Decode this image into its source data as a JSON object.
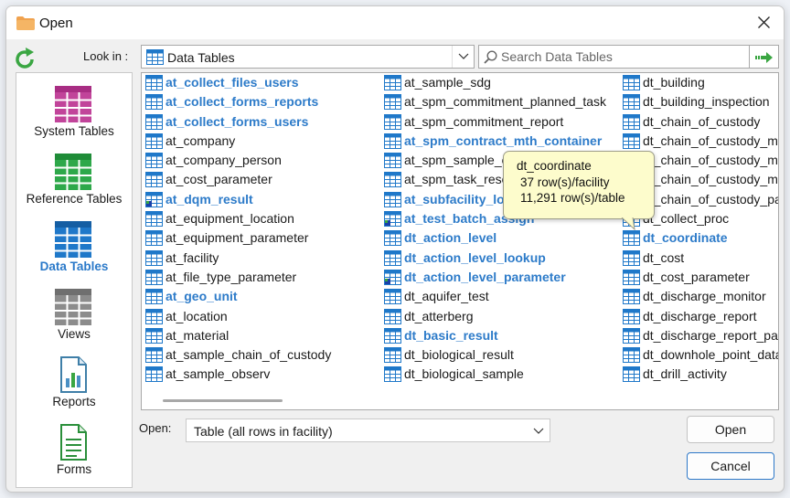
{
  "window": {
    "title": "Open",
    "folder_icon": "folder-icon",
    "close_icon": "close-icon"
  },
  "toolbar": {
    "refresh_icon": "refresh-icon",
    "lookin_label": "Look in :",
    "lookin_value": "Data Tables",
    "search_placeholder": "Search Data Tables",
    "search_go_icon": "arrow-right-icon"
  },
  "sidebar": {
    "items": [
      {
        "label": "System Tables",
        "icon": "system-tables-icon",
        "color": "#c1449a",
        "active": false
      },
      {
        "label": "Reference Tables",
        "icon": "reference-tables-icon",
        "color": "#2ea84a",
        "active": false
      },
      {
        "label": "Data Tables",
        "icon": "data-tables-icon",
        "color": "#1f78c9",
        "active": true
      },
      {
        "label": "Views",
        "icon": "views-icon",
        "color": "#8c8c8c",
        "active": false
      },
      {
        "label": "Reports",
        "icon": "reports-icon",
        "color": "#3f7fa8",
        "active": false
      },
      {
        "label": "Forms",
        "icon": "forms-icon",
        "color": "#2a8f3a",
        "active": false
      }
    ]
  },
  "list": {
    "columns": [
      [
        {
          "name": "at_collect_files_users",
          "bold": true,
          "marker": false
        },
        {
          "name": "at_collect_forms_reports",
          "bold": true,
          "marker": false
        },
        {
          "name": "at_collect_forms_users",
          "bold": true,
          "marker": false
        },
        {
          "name": "at_company",
          "bold": false,
          "marker": false
        },
        {
          "name": "at_company_person",
          "bold": false,
          "marker": false
        },
        {
          "name": "at_cost_parameter",
          "bold": false,
          "marker": false
        },
        {
          "name": "at_dqm_result",
          "bold": true,
          "marker": true
        },
        {
          "name": "at_equipment_location",
          "bold": false,
          "marker": false
        },
        {
          "name": "at_equipment_parameter",
          "bold": false,
          "marker": false
        },
        {
          "name": "at_facility",
          "bold": false,
          "marker": false
        },
        {
          "name": "at_file_type_parameter",
          "bold": false,
          "marker": false
        },
        {
          "name": "at_geo_unit",
          "bold": true,
          "marker": false
        },
        {
          "name": "at_location",
          "bold": false,
          "marker": false
        },
        {
          "name": "at_material",
          "bold": false,
          "marker": false
        },
        {
          "name": "at_sample_chain_of_custody",
          "bold": false,
          "marker": false
        },
        {
          "name": "at_sample_observ",
          "bold": false,
          "marker": false
        }
      ],
      [
        {
          "name": "at_sample_sdg",
          "bold": false,
          "marker": false
        },
        {
          "name": "at_spm_commitment_planned_task",
          "bold": false,
          "marker": false
        },
        {
          "name": "at_spm_commitment_report",
          "bold": false,
          "marker": false
        },
        {
          "name": "at_spm_contract_mth_container",
          "bold": true,
          "marker": false
        },
        {
          "name": "at_spm_sample_ch",
          "bold": false,
          "marker": false
        },
        {
          "name": "at_spm_task_reso",
          "bold": false,
          "marker": false
        },
        {
          "name": "at_subfacility_lo",
          "bold": true,
          "marker": false
        },
        {
          "name": "at_test_batch_assign",
          "bold": true,
          "marker": true
        },
        {
          "name": "dt_action_level",
          "bold": true,
          "marker": false
        },
        {
          "name": "dt_action_level_lookup",
          "bold": true,
          "marker": false
        },
        {
          "name": "dt_action_level_parameter",
          "bold": true,
          "marker": true
        },
        {
          "name": "dt_aquifer_test",
          "bold": false,
          "marker": false
        },
        {
          "name": "dt_atterberg",
          "bold": false,
          "marker": false
        },
        {
          "name": "dt_basic_result",
          "bold": true,
          "marker": false
        },
        {
          "name": "dt_biological_result",
          "bold": false,
          "marker": false
        },
        {
          "name": "dt_biological_sample",
          "bold": false,
          "marker": false
        }
      ],
      [
        {
          "name": "dt_building",
          "bold": false,
          "marker": false
        },
        {
          "name": "dt_building_inspection",
          "bold": false,
          "marker": false
        },
        {
          "name": "dt_chain_of_custody",
          "bold": false,
          "marker": false
        },
        {
          "name": "dt_chain_of_custody_ma",
          "bold": false,
          "marker": false
        },
        {
          "name": "dt_chain_of_custody_ma",
          "bold": false,
          "marker": false
        },
        {
          "name": "dt_chain_of_custody_ma",
          "bold": false,
          "marker": false
        },
        {
          "name": "dt_chain_of_custody_pa",
          "bold": false,
          "marker": false
        },
        {
          "name": "dt_collect_proc",
          "bold": false,
          "marker": false
        },
        {
          "name": "dt_coordinate",
          "bold": true,
          "marker": false
        },
        {
          "name": "dt_cost",
          "bold": false,
          "marker": false
        },
        {
          "name": "dt_cost_parameter",
          "bold": false,
          "marker": false
        },
        {
          "name": "dt_discharge_monitor",
          "bold": false,
          "marker": false
        },
        {
          "name": "dt_discharge_report",
          "bold": false,
          "marker": false
        },
        {
          "name": "dt_discharge_report_par",
          "bold": false,
          "marker": false
        },
        {
          "name": "dt_downhole_point_data",
          "bold": false,
          "marker": false
        },
        {
          "name": "dt_drill_activity",
          "bold": false,
          "marker": false
        }
      ]
    ]
  },
  "tooltip": {
    "title": "dt_coordinate",
    "line1": "37 row(s)/facility",
    "line2": "11,291 row(s)/table"
  },
  "footer": {
    "open_label": "Open:",
    "open_mode": "Table (all rows in facility)",
    "open_button": "Open",
    "cancel_button": "Cancel"
  },
  "colors": {
    "accent_blue": "#2d7bc9",
    "grid_blue": "#1f78c9",
    "tooltip_bg": "#fdfccc"
  }
}
